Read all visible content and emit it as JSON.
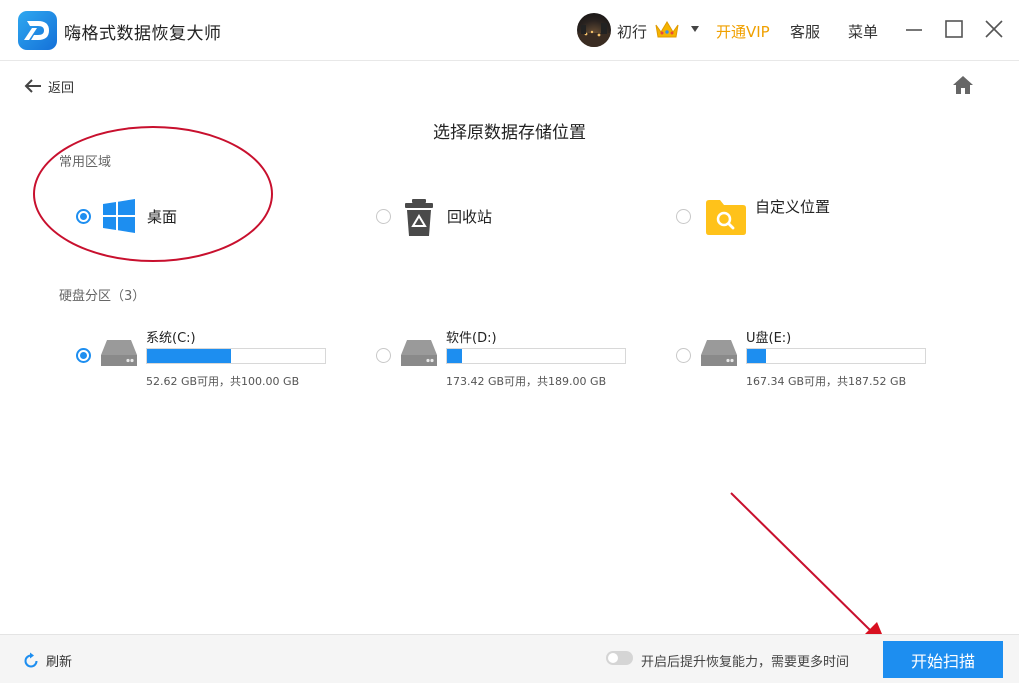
{
  "titlebar": {
    "app_title": "嗨格式数据恢复大师",
    "username": "初行",
    "vip_label": "开通VIP",
    "service_label": "客服",
    "menu_label": "菜单"
  },
  "nav": {
    "back_label": "返回"
  },
  "page_title": "选择原数据存储位置",
  "common_area": {
    "label": "常用区域",
    "options": [
      {
        "label": "桌面",
        "selected": true
      },
      {
        "label": "回收站",
        "selected": false
      },
      {
        "label": "自定义位置",
        "selected": false
      }
    ]
  },
  "partitions": {
    "label": "硬盘分区（3）",
    "disks": [
      {
        "name": "系统(C:)",
        "info": "52.62 GB可用，共100.00 GB",
        "used_fraction": 0.474,
        "selected": true
      },
      {
        "name": "软件(D:)",
        "info": "173.42 GB可用，共189.00 GB",
        "used_fraction": 0.082,
        "selected": false
      },
      {
        "name": "U盘(E:)",
        "info": "167.34 GB可用，共187.52 GB",
        "used_fraction": 0.108,
        "selected": false
      }
    ]
  },
  "footer": {
    "refresh_label": "刷新",
    "toggle_label": "开启后提升恢复能力，需要更多时间",
    "toggle_on": false,
    "scan_label": "开始扫描"
  },
  "colors": {
    "accent": "#1d8ef0",
    "vip": "#f0a000",
    "annotation": "#c8102e",
    "recycle_bin": "#4a4a4a",
    "custom_folder": "#ffc21a"
  }
}
